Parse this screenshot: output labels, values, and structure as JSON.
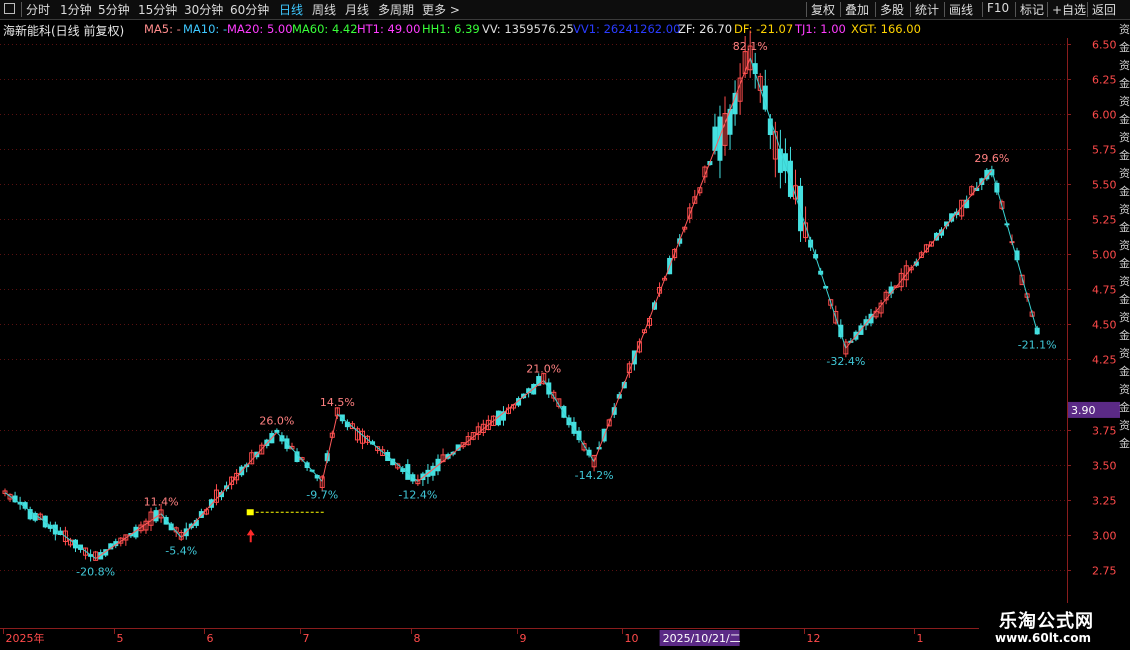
{
  "toolbar": {
    "left_tabs": [
      {
        "label": "分时"
      },
      {
        "label": "1分钟"
      },
      {
        "label": "5分钟"
      },
      {
        "label": "15分钟"
      },
      {
        "label": "30分钟"
      },
      {
        "label": "60分钟"
      },
      {
        "label": "日线",
        "active": true
      },
      {
        "label": "周线"
      },
      {
        "label": "月线"
      },
      {
        "label": "多周期"
      },
      {
        "label": "更多 >"
      }
    ],
    "right_buttons": [
      {
        "label": "复权"
      },
      {
        "label": "叠加"
      },
      {
        "label": "多股"
      },
      {
        "label": "统计"
      },
      {
        "label": "画线"
      },
      {
        "label": "F10"
      },
      {
        "label": "标记"
      },
      {
        "label": "+自选"
      },
      {
        "label": "返回"
      }
    ]
  },
  "indicators": {
    "stock_title": "海新能科(日线 前复权)",
    "ma5": "MA5: -",
    "ma10": "MA10: -",
    "ma20": "MA20: 5.00",
    "ma60": "MA60: 4.42",
    "ht1": "HT1: 49.00",
    "hh1": "HH1: 6.39",
    "vv": "VV: 1359576.25",
    "vv1": "VV1: 26241262.00",
    "zf": "ZF: 26.70",
    "df": "DF: -21.07",
    "tj1": "TJ1: 1.00",
    "xgt": "XGT: 166.00"
  },
  "colors": {
    "up": "#ff4d4d",
    "down": "#45e0e0",
    "zigzag_up": "#ff5a5a",
    "zigzag_down": "#3ad3d3",
    "axis": "#8a1d1d",
    "label_up": "#ff8080",
    "label_down": "#40c8d8",
    "current_price_bg": "#5b2a86",
    "date_highlight_bg": "#5b2a86",
    "signal_marker": "#ffff00",
    "signal_arrow": "#ff2a2a"
  },
  "watermark": {
    "title": "乐淘公式网",
    "url": "www.60lt.com"
  },
  "right_strip_text": "资金资金资金资金资金资金资金资金资金资金资金资金",
  "chart_data": {
    "type": "candlestick",
    "ylim": [
      2.5,
      6.6
    ],
    "y_ticks": [
      {
        "value": 6.5,
        "label": "6.50"
      },
      {
        "value": 6.25,
        "label": "6.25"
      },
      {
        "value": 6.0,
        "label": "6.00"
      },
      {
        "value": 5.75,
        "label": "5.75"
      },
      {
        "value": 5.5,
        "label": "5.50"
      },
      {
        "value": 5.25,
        "label": "5.25"
      },
      {
        "value": 5.0,
        "label": "5.00"
      },
      {
        "value": 4.75,
        "label": "4.75"
      },
      {
        "value": 4.5,
        "label": "4.50"
      },
      {
        "value": 4.25,
        "label": "4.25"
      },
      {
        "value": 3.75,
        "label": "3.75"
      },
      {
        "value": 3.5,
        "label": "3.50"
      },
      {
        "value": 3.25,
        "label": "3.25"
      },
      {
        "value": 3.0,
        "label": "3.00"
      },
      {
        "value": 2.75,
        "label": "2.75"
      }
    ],
    "current_price": "3.90",
    "x_months": [
      {
        "label": "2025年",
        "index": 0
      },
      {
        "label": "5",
        "index": 22
      },
      {
        "label": "6",
        "index": 40
      },
      {
        "label": "7",
        "index": 59
      },
      {
        "label": "8",
        "index": 81
      },
      {
        "label": "9",
        "index": 102
      },
      {
        "label": "10",
        "index": 123
      },
      {
        "label": "12",
        "index": 159
      },
      {
        "label": "1",
        "index": 181
      }
    ],
    "x_highlight": {
      "label": "2025/10/21/二",
      "index": 131
    },
    "zigzag": [
      {
        "index": 0,
        "price": 3.3
      },
      {
        "index": 18,
        "price": 2.83,
        "label": "-20.8%"
      },
      {
        "index": 31,
        "price": 3.15,
        "label": "11.4%"
      },
      {
        "index": 35,
        "price": 2.98,
        "label": "-5.4%"
      },
      {
        "index": 54,
        "price": 3.73,
        "label": "26.0%"
      },
      {
        "index": 63,
        "price": 3.38,
        "label": "-9.7%"
      },
      {
        "index": 66,
        "price": 3.86,
        "label": "14.5%"
      },
      {
        "index": 82,
        "price": 3.38,
        "label": "-12.4%"
      },
      {
        "index": 107,
        "price": 4.1,
        "label": "21.0%"
      },
      {
        "index": 117,
        "price": 3.52,
        "label": "-14.2%"
      },
      {
        "index": 148,
        "price": 6.4,
        "label": "82.1%"
      },
      {
        "index": 167,
        "price": 4.33,
        "label": "-32.4%"
      },
      {
        "index": 196,
        "price": 5.6,
        "label": "29.6%"
      },
      {
        "index": 205,
        "price": 4.45,
        "label": "-21.1%"
      }
    ],
    "signal": {
      "index": 49,
      "price": 3.16
    }
  }
}
